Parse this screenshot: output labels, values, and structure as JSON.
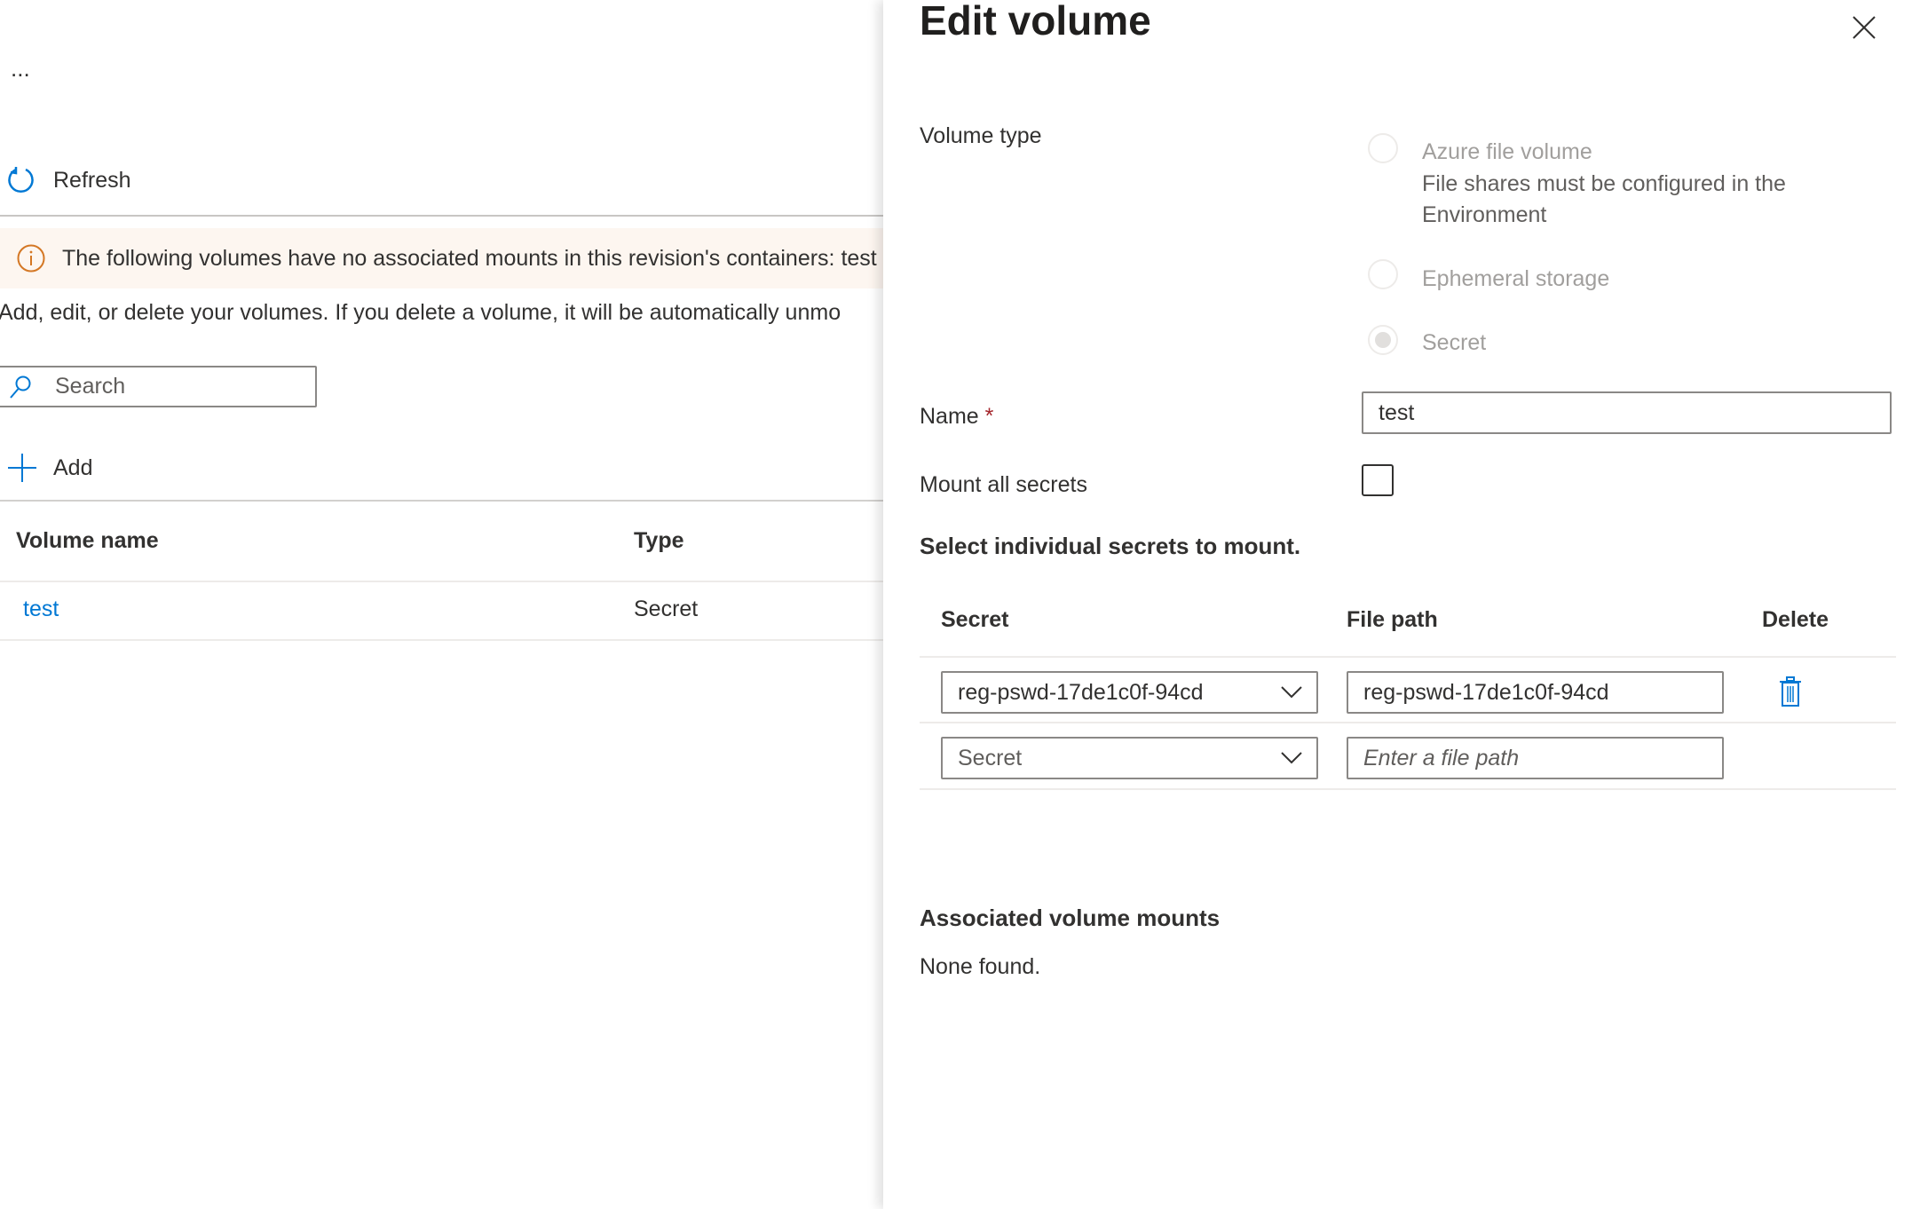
{
  "left": {
    "more_label": "...",
    "refresh_label": "Refresh",
    "banner_text": "The following volumes have no associated mounts in this revision's containers: test",
    "description": "Add, edit, or delete your volumes. If you delete a volume, it will be automatically unmo",
    "search_placeholder": "Search",
    "add_label": "Add",
    "table": {
      "columns": [
        "Volume name",
        "Type"
      ],
      "rows": [
        {
          "name": "test",
          "type": "Secret"
        }
      ]
    }
  },
  "panel": {
    "title": "Edit volume",
    "volume_type_label": "Volume type",
    "volume_types": [
      {
        "label": "Azure file volume",
        "note": [
          "File shares must be configured in the",
          "Environment"
        ],
        "selected": false
      },
      {
        "label": "Ephemeral storage",
        "selected": false
      },
      {
        "label": "Secret",
        "selected": true
      }
    ],
    "name_label": "Name",
    "required_mark": "*",
    "name_value": "test",
    "mount_all_label": "Mount all secrets",
    "mount_all_checked": false,
    "select_heading": "Select individual secrets to mount.",
    "secrets_table": {
      "columns": [
        "Secret",
        "File path",
        "Delete"
      ],
      "rows": [
        {
          "secret": "reg-pswd-17de1c0f-94cd",
          "file_path": "reg-pswd-17de1c0f-94cd"
        },
        {
          "secret": "Secret",
          "file_path_placeholder": "Enter a file path"
        }
      ]
    },
    "associated_heading": "Associated volume mounts",
    "associated_value": "None found."
  },
  "colors": {
    "accent": "#0078d4",
    "warning": "#d47724",
    "banner_bg": "#fdf6f0",
    "required": "#a4262c"
  }
}
